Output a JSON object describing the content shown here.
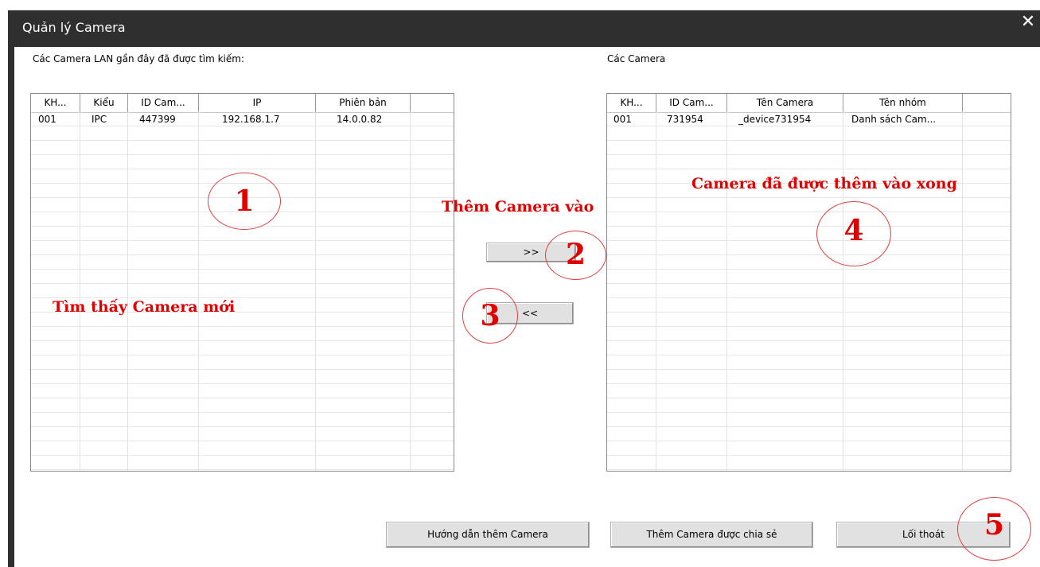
{
  "window": {
    "title": "Quản lý Camera",
    "close_glyph": "✕"
  },
  "left_panel": {
    "caption": "Các Camera LAN gần đây đã được tìm kiếm:",
    "columns": [
      "KH...",
      "Kiểu",
      "ID Cam...",
      "IP",
      "Phiên bản"
    ],
    "rows": [
      [
        "001",
        "IPC",
        "447399",
        "192.168.1.7",
        "14.0.0.82"
      ]
    ]
  },
  "right_panel": {
    "caption": "Các Camera",
    "columns": [
      "KH...",
      "ID Cam...",
      "Tên Camera",
      "Tên nhóm"
    ],
    "rows": [
      [
        "001",
        "731954",
        "_device731954",
        "Danh sách Cam..."
      ]
    ]
  },
  "buttons": {
    "add": ">>",
    "remove": "<<",
    "guide": "Hướng dẫn thêm Camera",
    "shared": "Thêm Camera được chia sẻ",
    "exit": "Lối thoát"
  },
  "annotations": {
    "found_new": "Tìm thấy Camera mới",
    "add_camera": "Thêm Camera vào",
    "added_done": "Camera đã được thêm vào xong",
    "n1": "1",
    "n2": "2",
    "n3": "3",
    "n4": "4",
    "n5": "5",
    "color": "#e00000"
  }
}
